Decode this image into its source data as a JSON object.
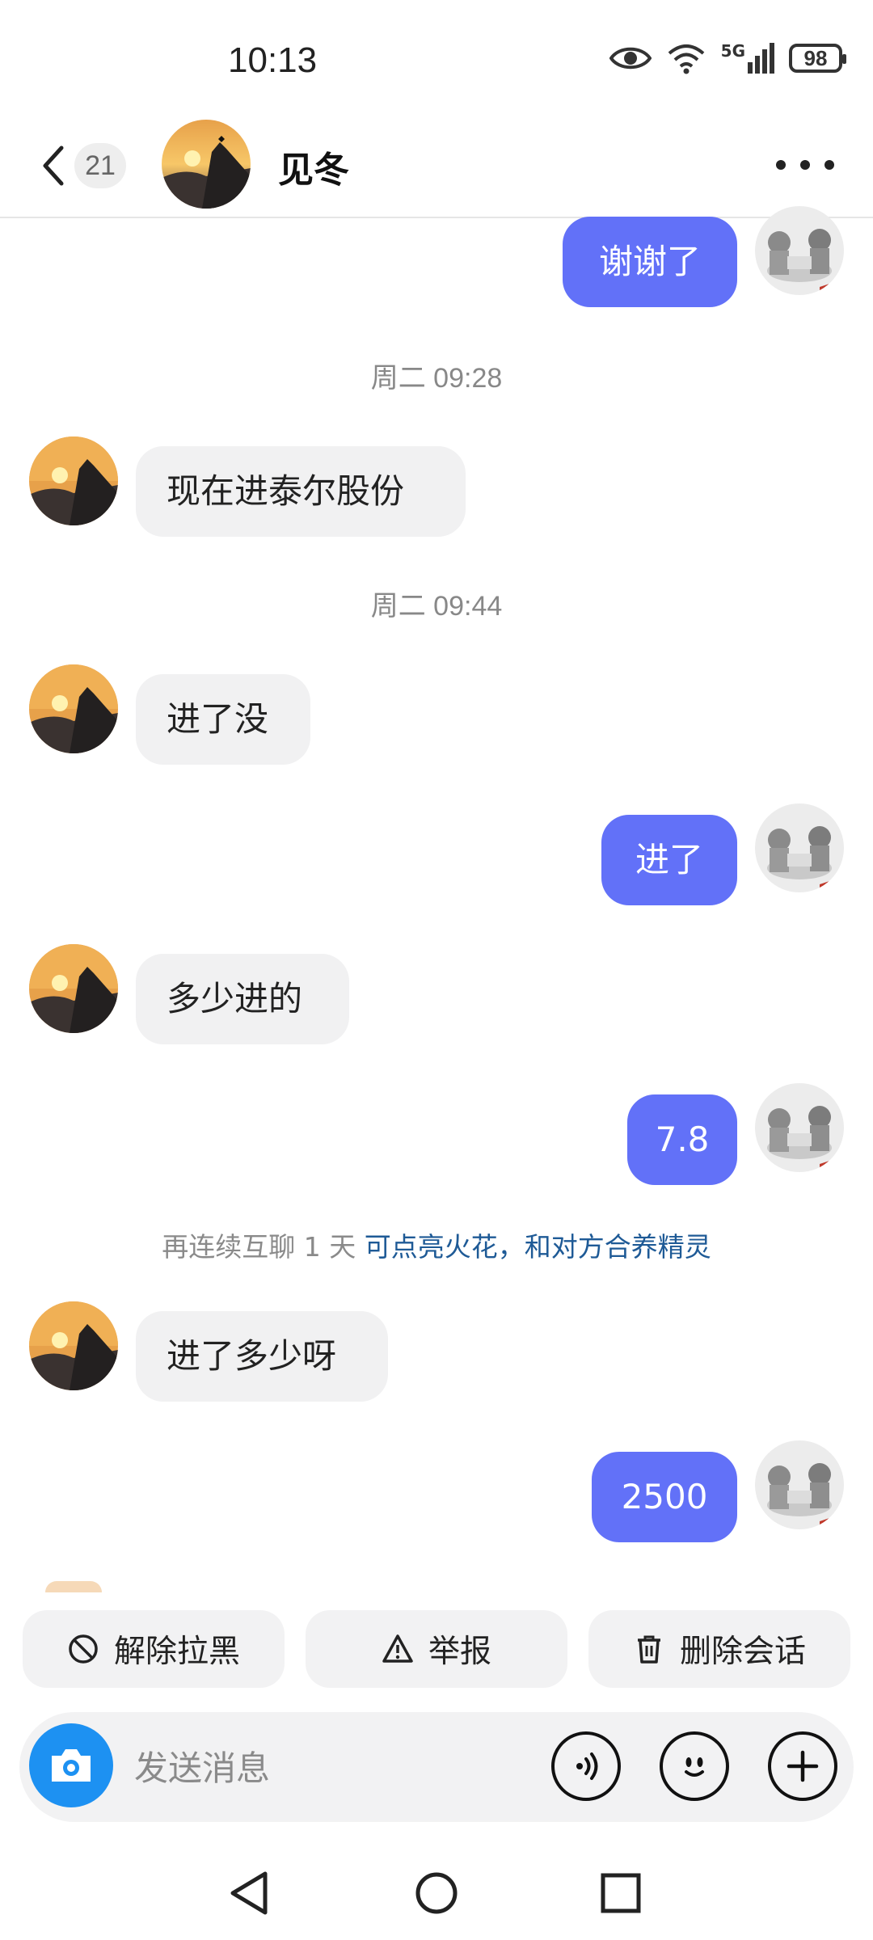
{
  "status_bar": {
    "time": "10:13",
    "battery": "98",
    "network": "5G"
  },
  "header": {
    "unread_count": "21",
    "contact_name": "见冬"
  },
  "messages": [
    {
      "side": "out",
      "text": "谢谢了"
    },
    {
      "timestamp": "周二 09:28"
    },
    {
      "side": "in",
      "text": "现在进泰尔股份"
    },
    {
      "timestamp": "周二 09:44"
    },
    {
      "side": "in",
      "text": "进了没"
    },
    {
      "side": "out",
      "text": "进了"
    },
    {
      "side": "in",
      "text": "多少进的"
    },
    {
      "side": "out",
      "text": "7.8"
    },
    {
      "notice": "再连续互聊 1 天",
      "notice_link": "可点亮火花，和对方合养精灵"
    },
    {
      "side": "in",
      "text": "进了多少呀"
    },
    {
      "side": "out",
      "text": "2500"
    }
  ],
  "actions": {
    "unblock": "解除拉黑",
    "report": "举报",
    "delete": "删除会话"
  },
  "input": {
    "placeholder": "发送消息"
  },
  "colors": {
    "outgoing_bubble": "#6271f8",
    "incoming_bubble": "#f1f1f2",
    "camera": "#1d91f2",
    "link": "#1e5a96"
  }
}
